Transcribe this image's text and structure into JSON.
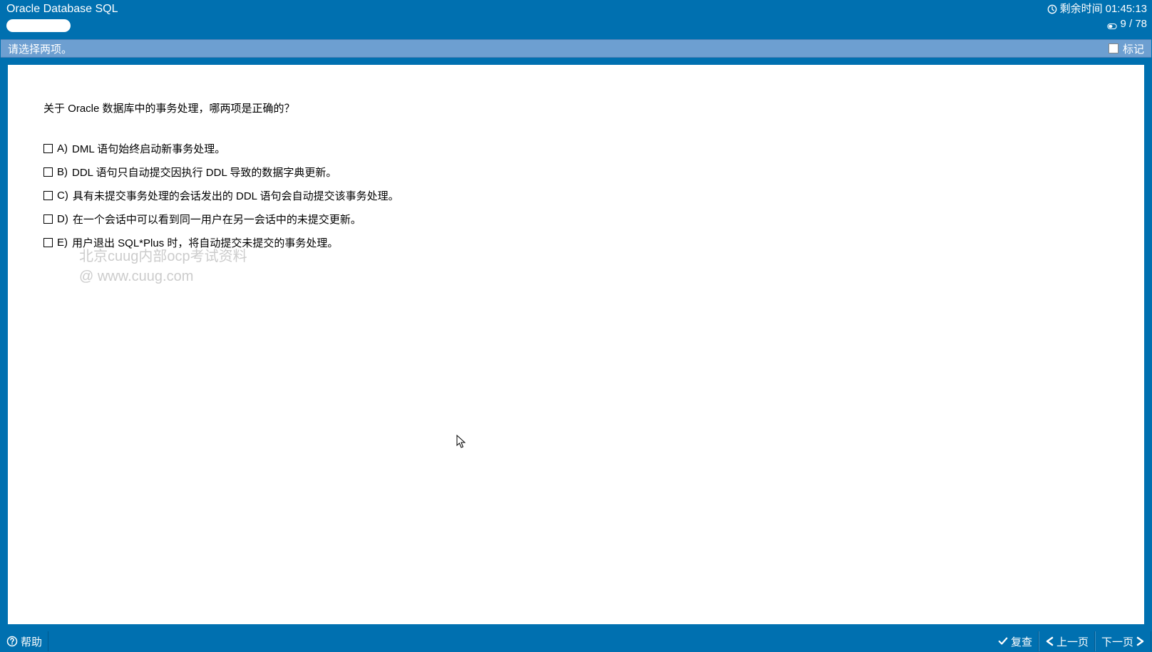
{
  "header": {
    "title": "Oracle Database SQL",
    "time_label": "剩余时间",
    "time_value": "01:45:13",
    "progress": "9 / 78"
  },
  "instruction": {
    "text": "请选择两项。",
    "mark_label": "标记"
  },
  "question": {
    "text": "关于 Oracle 数据库中的事务处理，哪两项是正确的？",
    "options": [
      {
        "letter": "A)",
        "text": "DML 语句始终启动新事务处理。"
      },
      {
        "letter": "B)",
        "text": "DDL 语句只自动提交因执行 DDL 导致的数据字典更新。"
      },
      {
        "letter": "C)",
        "text": "具有未提交事务处理的会话发出的 DDL 语句会自动提交该事务处理。"
      },
      {
        "letter": "D)",
        "text": "在一个会话中可以看到同一用户在另一会话中的未提交更新。"
      },
      {
        "letter": "E)",
        "text": "用户退出 SQL*Plus 时，将自动提交未提交的事务处理。"
      }
    ]
  },
  "watermark": {
    "line1": "北京cuug内部ocp考试资料",
    "line2": "@ www.cuug.com"
  },
  "footer": {
    "help": "帮助",
    "review": "复查",
    "prev": "上一页",
    "next": "下一页"
  }
}
